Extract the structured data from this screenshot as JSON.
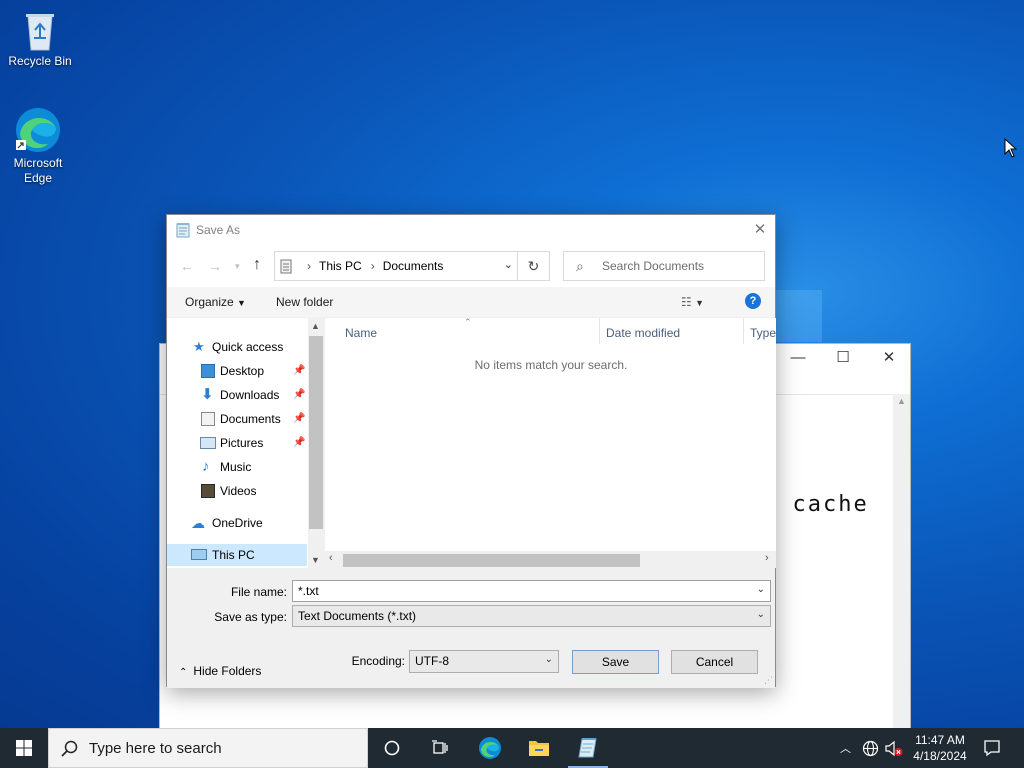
{
  "desktop": {
    "icons": [
      {
        "label": "Recycle Bin",
        "icon": "recycle-bin-icon"
      },
      {
        "label": "Microsoft Edge",
        "icon": "edge-icon"
      }
    ]
  },
  "background_window": {
    "visible_text": "a  cache"
  },
  "dialog": {
    "title": "Save As",
    "address": {
      "crumbs": [
        "This PC",
        "Documents"
      ]
    },
    "search": {
      "placeholder": "Search Documents"
    },
    "toolbar": {
      "organize": "Organize",
      "new_folder": "New folder"
    },
    "nav": {
      "quick_access": "Quick access",
      "items": [
        {
          "label": "Desktop",
          "pinned": true
        },
        {
          "label": "Downloads",
          "pinned": true
        },
        {
          "label": "Documents",
          "pinned": true
        },
        {
          "label": "Pictures",
          "pinned": true
        },
        {
          "label": "Music",
          "pinned": false
        },
        {
          "label": "Videos",
          "pinned": false
        }
      ],
      "onedrive": "OneDrive",
      "this_pc": "This PC"
    },
    "columns": [
      "Name",
      "Date modified",
      "Type"
    ],
    "empty_message": "No items match your search.",
    "file_name": {
      "label": "File name:",
      "value": "*.txt"
    },
    "save_as_type": {
      "label": "Save as type:",
      "value": "Text Documents (*.txt)"
    },
    "encoding": {
      "label": "Encoding:",
      "value": "UTF-8"
    },
    "buttons": {
      "save": "Save",
      "cancel": "Cancel",
      "hide_folders": "Hide Folders"
    }
  },
  "taskbar": {
    "search_placeholder": "Type here to search",
    "time": "11:47 AM",
    "date": "4/18/2024"
  },
  "colors": {
    "accent": "#0078d7",
    "taskbar": "#1f2a33",
    "selection": "#cce8ff"
  }
}
